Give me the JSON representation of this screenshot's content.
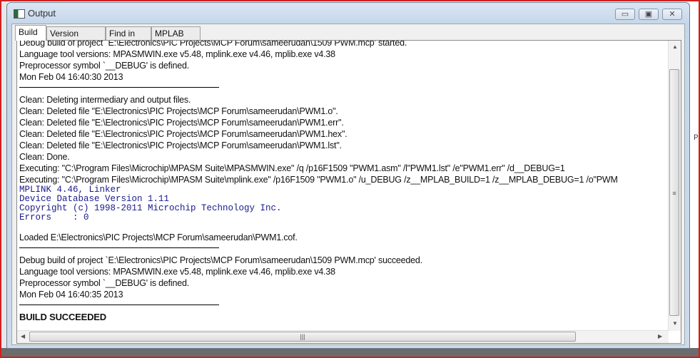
{
  "window": {
    "title": "Output",
    "icon": "output-window-icon",
    "controls": {
      "minimize": "▭",
      "maximize": "▣",
      "close": "✕"
    }
  },
  "tabs": [
    {
      "label": "Build",
      "active": true
    },
    {
      "label": "Version Control",
      "active": false
    },
    {
      "label": "Find in Files",
      "active": false
    },
    {
      "label": "MPLAB SIM",
      "active": false
    }
  ],
  "output": {
    "lines": [
      "Debug build of project `E:\\Electronics\\PIC Projects\\MCP Forum\\sameerudan\\1509 PWM.mcp' started.",
      "Language tool versions: MPASMWIN.exe v5.48, mplink.exe v4.46, mplib.exe v4.38",
      "Preprocessor symbol `__DEBUG' is defined.",
      "Mon Feb 04 16:40:30 2013",
      "Clean: Deleting intermediary and output files.",
      "Clean: Deleted file \"E:\\Electronics\\PIC Projects\\MCP Forum\\sameerudan\\PWM1.o\".",
      "Clean: Deleted file \"E:\\Electronics\\PIC Projects\\MCP Forum\\sameerudan\\PWM1.err\".",
      "Clean: Deleted file \"E:\\Electronics\\PIC Projects\\MCP Forum\\sameerudan\\PWM1.hex\".",
      "Clean: Deleted file \"E:\\Electronics\\PIC Projects\\MCP Forum\\sameerudan\\PWM1.lst\".",
      "Clean: Done.",
      "Executing: \"C:\\Program Files\\Microchip\\MPASM Suite\\MPASMWIN.exe\" /q /p16F1509 \"PWM1.asm\" /l\"PWM1.lst\" /e\"PWM1.err\" /d__DEBUG=1",
      "Executing: \"C:\\Program Files\\Microchip\\MPASM Suite\\mplink.exe\" /p16F1509 \"PWM1.o\" /u_DEBUG /z__MPLAB_BUILD=1 /z__MPLAB_DEBUG=1 /o\"PWM",
      "MPLINK 4.46, Linker",
      "Device Database Version 1.11",
      "Copyright (c) 1998-2011 Microchip Technology Inc.",
      "Errors    : 0",
      "Loaded E:\\Electronics\\PIC Projects\\MCP Forum\\sameerudan\\PWM1.cof.",
      "Debug build of project `E:\\Electronics\\PIC Projects\\MCP Forum\\sameerudan\\1509 PWM.mcp' succeeded.",
      "Language tool versions: MPASMWIN.exe v5.48, mplink.exe v4.46, mplib.exe v4.38",
      "Preprocessor symbol `__DEBUG' is defined.",
      "Mon Feb 04 16:40:35 2013",
      "BUILD SUCCEEDED"
    ]
  },
  "background_fragment": "P",
  "colors": {
    "linker_text": "#1a1a8c",
    "frame": "#d02020"
  }
}
